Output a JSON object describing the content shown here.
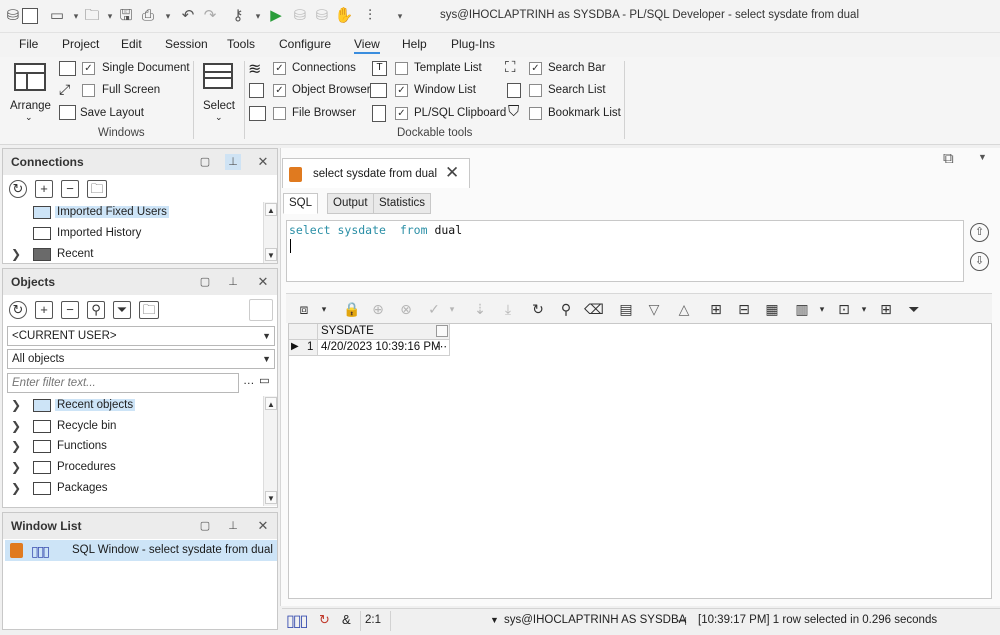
{
  "window": {
    "title": "sys@IHOCLAPTRINH as SYSDBA - PL/SQL Developer - select sysdate from dual"
  },
  "menu": [
    "File",
    "Project",
    "Edit",
    "Session",
    "Tools",
    "Configure",
    "View",
    "Help",
    "Plug-Ins"
  ],
  "ribbon": {
    "windows_group": {
      "arrange": "Arrange",
      "single_document": "Single Document",
      "full_screen": "Full Screen",
      "save_layout": "Save Layout",
      "label": "Windows"
    },
    "select": "Select",
    "dockable_group": {
      "connections": "Connections",
      "object_browser": "Object Browser",
      "file_browser": "File Browser",
      "template_list": "Template List",
      "window_list": "Window List",
      "plsql_clipboard": "PL/SQL Clipboard",
      "search_bar": "Search Bar",
      "search_list": "Search List",
      "bookmark_list": "Bookmark List",
      "label": "Dockable tools"
    }
  },
  "connections_panel": {
    "title": "Connections",
    "items": [
      "Imported Fixed Users",
      "Imported History",
      "Recent"
    ]
  },
  "objects_panel": {
    "title": "Objects",
    "user_combo": "<CURRENT USER>",
    "objects_combo": "All objects",
    "filter_placeholder": "Enter filter text...",
    "items": [
      "Recent objects",
      "Recycle bin",
      "Functions",
      "Procedures",
      "Packages"
    ]
  },
  "window_list_panel": {
    "title": "Window List",
    "items": [
      "SQL Window - select sysdate from dual"
    ]
  },
  "document": {
    "tab_title": "select sysdate from dual",
    "subtabs": [
      "SQL",
      "Output",
      "Statistics"
    ],
    "sql": {
      "kw1": "select",
      "ident": "sysdate",
      "kw2": "from",
      "table": "dual"
    },
    "grid": {
      "columns": [
        "SYSDATE"
      ],
      "rows": [
        {
          "num": "1",
          "values": [
            "4/20/2023 10:39:16 PM"
          ]
        }
      ]
    }
  },
  "statusbar": {
    "position": "2:1",
    "connection": "sys@IHOCLAPTRINH AS SYSDBA",
    "message": "[10:39:17 PM]  1 row selected in 0.296 seconds"
  }
}
